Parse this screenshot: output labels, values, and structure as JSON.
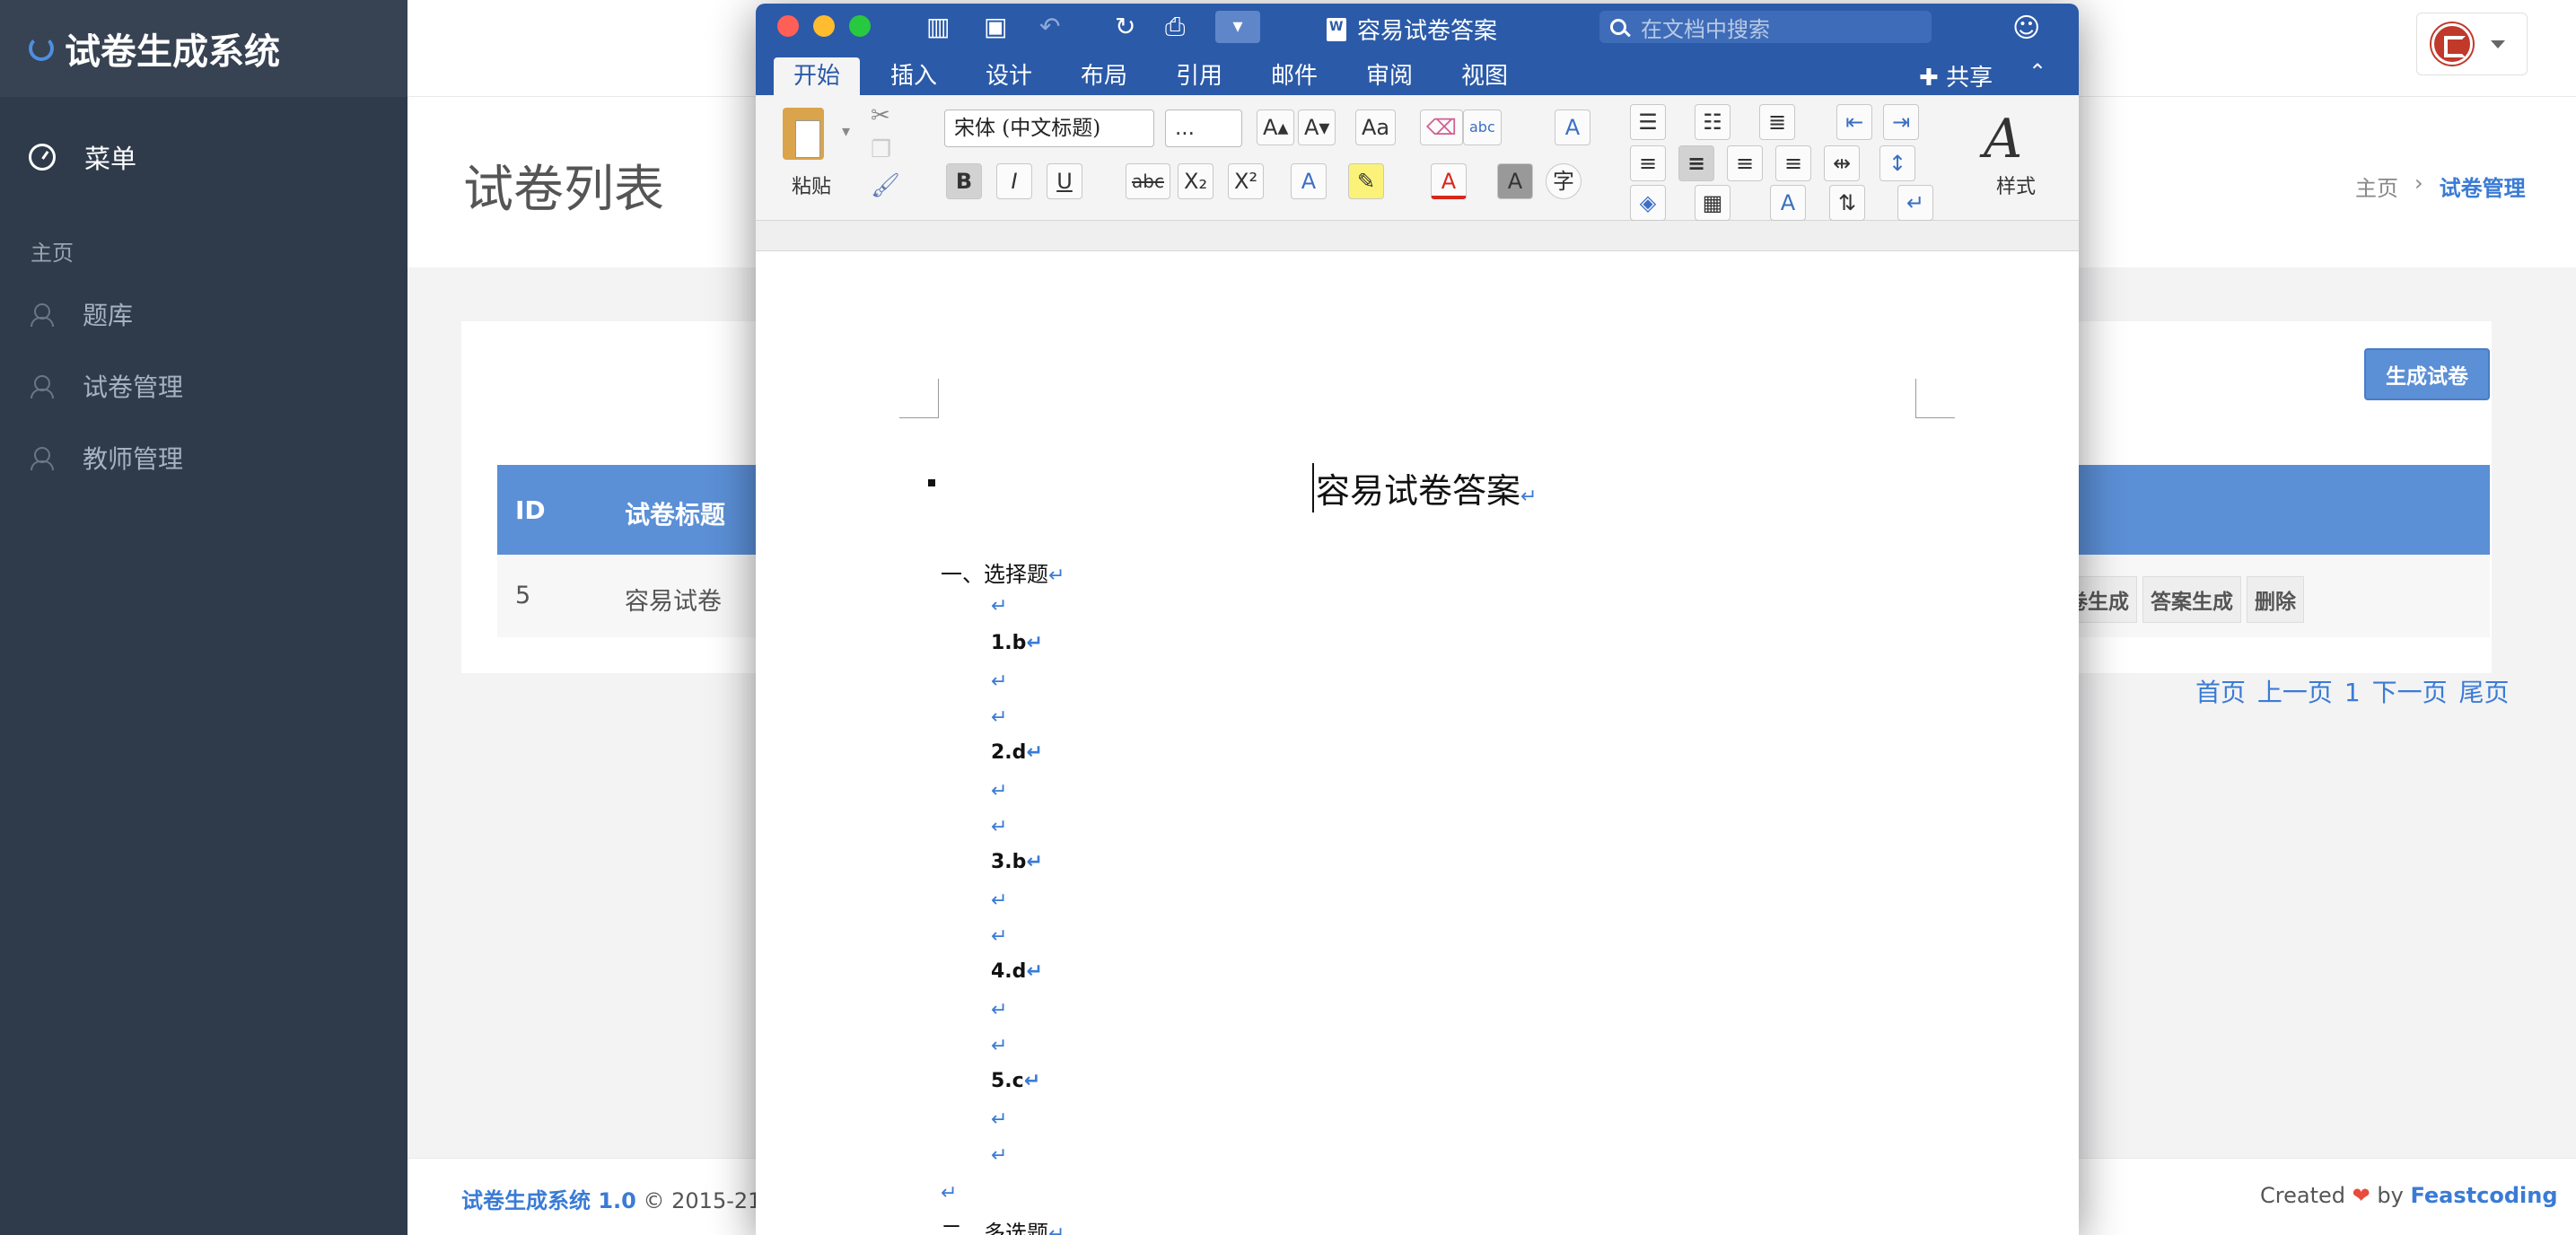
{
  "app": {
    "brand": "试卷生成系统",
    "menu_head": "菜单",
    "group_label": "主页",
    "nav": [
      "题库",
      "试卷管理",
      "教师管理"
    ]
  },
  "header": {
    "page_title": "试卷列表",
    "breadcrumb": [
      "主页",
      "›",
      "试卷管理"
    ]
  },
  "content": {
    "generate_button": "生成试卷",
    "table": {
      "columns": [
        "ID",
        "试卷标题"
      ],
      "rows": [
        {
          "id": "5",
          "title": "容易试卷"
        }
      ],
      "actions": [
        "卷生成",
        "答案生成",
        "删除"
      ]
    },
    "pager": [
      "首页",
      "上一页",
      "1",
      "下一页",
      "尾页"
    ]
  },
  "footer": {
    "left_brand": "试卷生成系统 1.0",
    "left_text": "© 2015-21",
    "right_created": "Created",
    "right_heart": "❤",
    "right_by": "by",
    "right_brand": "Feastcoding"
  },
  "word": {
    "doc_title": "容易试卷答案",
    "search_placeholder": "在文档中搜索",
    "tabs": [
      "开始",
      "插入",
      "设计",
      "布局",
      "引用",
      "邮件",
      "审阅",
      "视图"
    ],
    "share": "共享",
    "ribbon": {
      "paste": "粘贴",
      "font": "宋体 (中文标题)",
      "size": "...",
      "styles": "样式"
    },
    "document": {
      "heading": "容易试卷答案",
      "pilcrow": "↵",
      "section1": "一、选择题",
      "answers": [
        "1.b",
        "2.d",
        "3.b",
        "4.d",
        "5.c"
      ],
      "section2": "二、多选题"
    }
  },
  "colors": {
    "sidebar": "#2f3a4a",
    "accent": "#5b8fd6",
    "word_blue": "#2b5aa8"
  }
}
